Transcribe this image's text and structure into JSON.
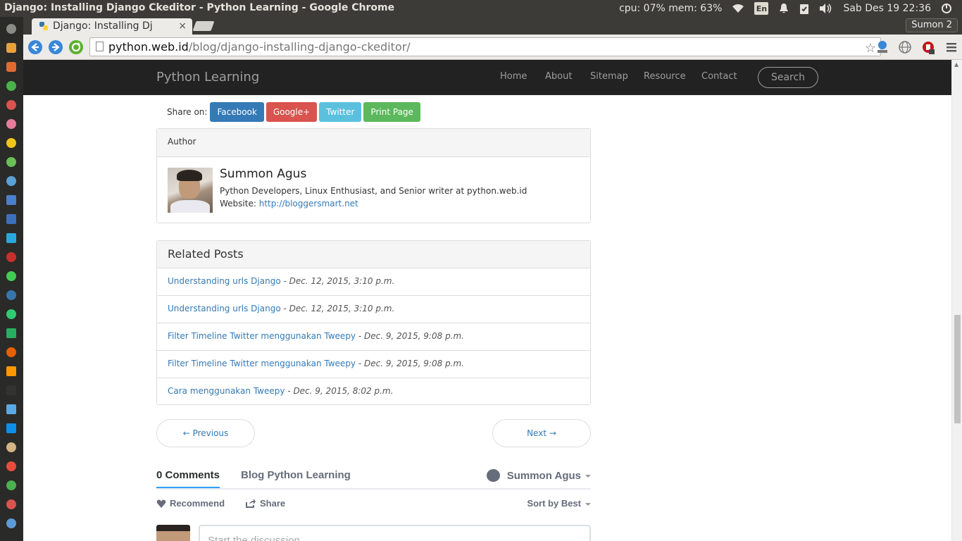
{
  "system_bar": {
    "window_title": "Django: Installing Django Ckeditor - Python Learning - Google Chrome",
    "cpu_mem": "cpu: 07% mem: 63%",
    "keyboard": "En",
    "datetime": "Sab Des 19 22:36"
  },
  "browser": {
    "tab_title": "Django: Installing Dj",
    "tab_close": "×",
    "profile_name": "Sumon 2",
    "url_host": "python.web.id",
    "url_path": "/blog/django-installing-django-ckeditor/",
    "star": "☆"
  },
  "site": {
    "brand": "Python Learning",
    "nav": [
      "Home",
      "About",
      "Sitemap",
      "Resource",
      "Contact"
    ],
    "search_label": "Search"
  },
  "share": {
    "label": "Share on:",
    "buttons": [
      "Facebook",
      "Google+",
      "Twitter",
      "Print Page"
    ],
    "colors": [
      "#337ab7",
      "#d9534f",
      "#5bc0de",
      "#5cb85c"
    ]
  },
  "author": {
    "heading": "Author",
    "name": "Summon Agus",
    "description": "Python Developers, Linux Enthusiast, and Senior writer at python.web.id",
    "website_label": "Website:",
    "website_url": "http://bloggersmart.net"
  },
  "related": {
    "heading": "Related Posts",
    "items": [
      {
        "title": "Understanding urls Django",
        "date": "- Dec. 12, 2015, 3:10 p.m."
      },
      {
        "title": "Understanding urls Django",
        "date": "- Dec. 12, 2015, 3:10 p.m."
      },
      {
        "title": "Filter Timeline Twitter menggunakan Tweepy",
        "date": "- Dec. 9, 2015, 9:08 p.m."
      },
      {
        "title": "Filter Timeline Twitter menggunakan Tweepy",
        "date": "- Dec. 9, 2015, 9:08 p.m."
      },
      {
        "title": "Cara menggunakan Tweepy",
        "date": "- Dec. 9, 2015, 8:02 p.m."
      }
    ]
  },
  "pager": {
    "previous": "← Previous",
    "next": "Next →"
  },
  "disqus": {
    "comments_tab": "0 Comments",
    "community_tab": "Blog Python Learning",
    "user": "Summon Agus",
    "recommend": "Recommend",
    "share": "Share",
    "sort": "Sort by Best",
    "placeholder": "Start the discussion..."
  }
}
